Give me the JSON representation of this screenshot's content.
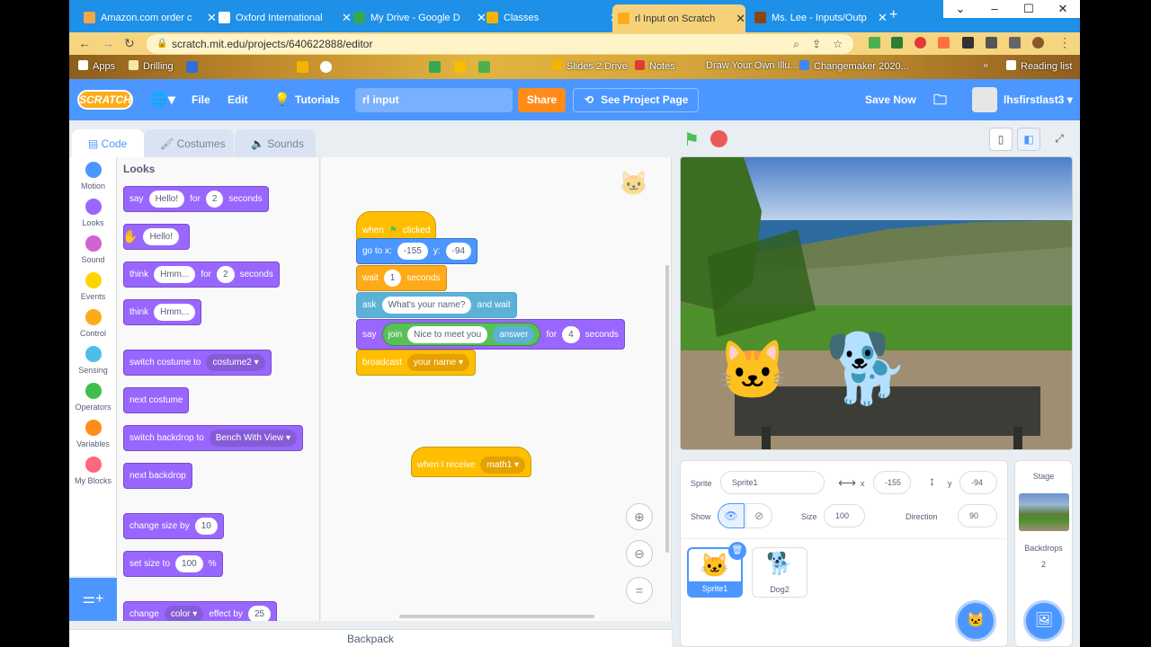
{
  "browser": {
    "tabs": [
      {
        "label": "Amazon.com order c",
        "color": "#f3a847"
      },
      {
        "label": "Oxford International",
        "color": "#1d1d1d"
      },
      {
        "label": "My Drive - Google D",
        "color": "#34a853"
      },
      {
        "label": "Classes",
        "color": "#f4b400"
      },
      {
        "label": "rl Input on Scratch",
        "color": "#ffab19"
      },
      {
        "label": "Ms. Lee - Inputs/Outp",
        "color": "#8b4513"
      }
    ],
    "url": "scratch.mit.edu/projects/640622888/editor",
    "bookmarks": [
      "Apps",
      "Drilling",
      "Slides 2 Drive",
      "Notes",
      "Draw Your Own Illu...",
      "Changemaker 2020...",
      "Reading list"
    ]
  },
  "menu": {
    "logo": "SCRATCH",
    "file": "File",
    "edit": "Edit",
    "tutorials": "Tutorials",
    "project_title": "rl input",
    "share": "Share",
    "see_project_page": "See Project Page",
    "save_now": "Save Now",
    "username": "lhsfirstlast3"
  },
  "editor_tabs": {
    "code": "Code",
    "costumes": "Costumes",
    "sounds": "Sounds"
  },
  "categories": [
    {
      "label": "Motion",
      "color": "#4c97ff"
    },
    {
      "label": "Looks",
      "color": "#9966ff"
    },
    {
      "label": "Sound",
      "color": "#cf63cf"
    },
    {
      "label": "Events",
      "color": "#ffd500"
    },
    {
      "label": "Control",
      "color": "#ffab19"
    },
    {
      "label": "Sensing",
      "color": "#4cbfe6"
    },
    {
      "label": "Operators",
      "color": "#40bf4a"
    },
    {
      "label": "Variables",
      "color": "#ff8c1a"
    },
    {
      "label": "My Blocks",
      "color": "#ff6680"
    }
  ],
  "palette": {
    "heading": "Looks",
    "b1": {
      "say": "say",
      "msg": "Hello!",
      "for": "for",
      "secs": "2",
      "seconds": "seconds"
    },
    "b2": {
      "msg": "Hello!"
    },
    "b3": {
      "think": "think",
      "msg": "Hmm...",
      "for": "for",
      "secs": "2",
      "seconds": "seconds"
    },
    "b4": {
      "think": "think",
      "msg": "Hmm..."
    },
    "b5": {
      "label": "switch costume to",
      "value": "costume2"
    },
    "b6": {
      "label": "next costume"
    },
    "b7": {
      "label": "switch backdrop to",
      "value": "Bench With View"
    },
    "b8": {
      "label": "next backdrop"
    },
    "b9": {
      "label": "change size by",
      "value": "10"
    },
    "b10": {
      "label": "set size to",
      "value": "100",
      "unit": "%"
    },
    "b11": {
      "change": "change",
      "effect": "color",
      "label": "effect by",
      "value": "25"
    }
  },
  "script": {
    "when_clicked": {
      "when": "when",
      "clicked": "clicked"
    },
    "goto": {
      "label": "go to x:",
      "x": "-155",
      "ylabel": "y:",
      "y": "-94"
    },
    "wait": {
      "label": "wait",
      "value": "1",
      "seconds": "seconds"
    },
    "ask": {
      "label": "ask",
      "value": "What's your name?",
      "and_wait": "and wait"
    },
    "say": {
      "label": "say",
      "join": "join",
      "text": "Nice to meet you",
      "answer": "answer",
      "for": "for",
      "secs": "4",
      "seconds": "seconds"
    },
    "broadcast": {
      "label": "broadcast",
      "value": "your name"
    },
    "when_receive": {
      "label": "when I receive",
      "value": "math1"
    }
  },
  "backpack": "Backpack",
  "sprite_info": {
    "sprite_label": "Sprite",
    "sprite_name": "Sprite1",
    "x_label": "x",
    "x": "-155",
    "y_label": "y",
    "y": "-94",
    "show_label": "Show",
    "size_label": "Size",
    "size": "100",
    "direction_label": "Direction",
    "direction": "90"
  },
  "sprites": [
    {
      "name": "Sprite1"
    },
    {
      "name": "Dog2"
    }
  ],
  "stage_panel": {
    "title": "Stage",
    "backdrops_label": "Backdrops",
    "backdrops_count": "2"
  }
}
